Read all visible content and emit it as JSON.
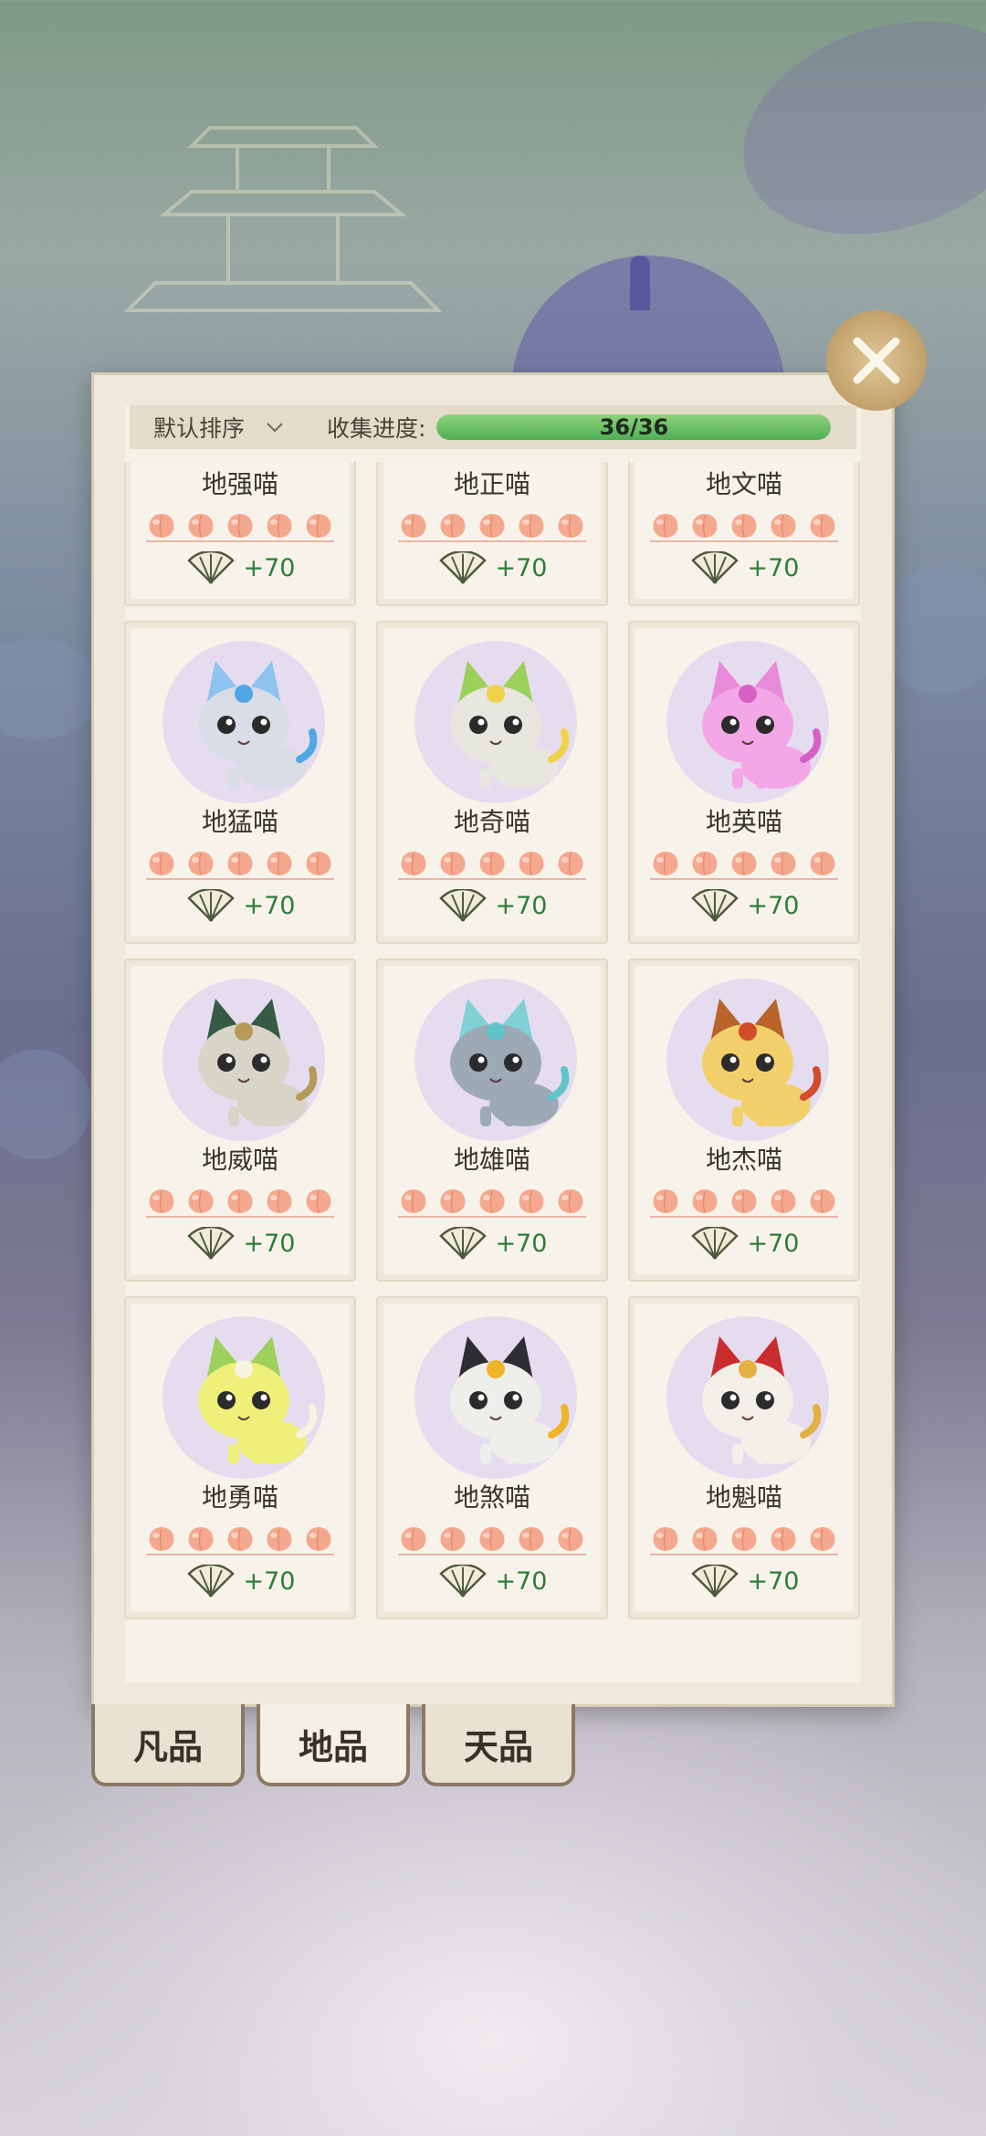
{
  "header": {
    "sort_label": "默认排序",
    "progress_label": "收集进度:",
    "progress_text": "36/36",
    "progress_fraction": 1.0
  },
  "cards": [
    {
      "name": "地强喵",
      "bonus": "+70",
      "peaches": 5,
      "portrait": "partial"
    },
    {
      "name": "地正喵",
      "bonus": "+70",
      "peaches": 5,
      "portrait": "partial"
    },
    {
      "name": "地文喵",
      "bonus": "+70",
      "peaches": 5,
      "portrait": "partial"
    },
    {
      "name": "地猛喵",
      "bonus": "+70",
      "peaches": 5,
      "portrait": "gray-blue-cat",
      "body": "#d9dde6",
      "ear": "#8ec3f0",
      "accent": "#4fa7e6"
    },
    {
      "name": "地奇喵",
      "bonus": "+70",
      "peaches": 5,
      "portrait": "leaf-cat",
      "body": "#e7e6df",
      "ear": "#9bd05a",
      "accent": "#f0d24a"
    },
    {
      "name": "地英喵",
      "bonus": "+70",
      "peaches": 5,
      "portrait": "pink-cat",
      "body": "#f3a7e6",
      "ear": "#e98ad9",
      "accent": "#d561c4"
    },
    {
      "name": "地威喵",
      "bonus": "+70",
      "peaches": 5,
      "portrait": "green-hood-cat",
      "body": "#d7d5c8",
      "ear": "#355a45",
      "accent": "#b69a58"
    },
    {
      "name": "地雄喵",
      "bonus": "+70",
      "peaches": 5,
      "portrait": "teal-cat",
      "body": "#9ea9b6",
      "ear": "#7fd1d6",
      "accent": "#5ec5c9"
    },
    {
      "name": "地杰喵",
      "bonus": "+70",
      "peaches": 5,
      "portrait": "gold-dragon-cat",
      "body": "#f2cf6a",
      "ear": "#b9642a",
      "accent": "#d24c2a"
    },
    {
      "name": "地勇喵",
      "bonus": "+70",
      "peaches": 5,
      "portrait": "lime-cat",
      "body": "#eef07a",
      "ear": "#9ed05d",
      "accent": "#f6f3e1"
    },
    {
      "name": "地煞喵",
      "bonus": "+70",
      "peaches": 5,
      "portrait": "black-gold-cat",
      "body": "#eeeeea",
      "ear": "#2d2d33",
      "accent": "#f0b429"
    },
    {
      "name": "地魁喵",
      "bonus": "+70",
      "peaches": 5,
      "portrait": "red-crown-cat",
      "body": "#f3efe9",
      "ear": "#c92d2d",
      "accent": "#e3b043"
    }
  ],
  "tabs": [
    {
      "label": "凡品",
      "active": false
    },
    {
      "label": "地品",
      "active": true
    },
    {
      "label": "天品",
      "active": false
    }
  ],
  "colors": {
    "bonus_text": "#2e7d3a",
    "progress_fill": "#4fae55",
    "peach": "#f2a287"
  },
  "icons": {
    "close": "close-icon",
    "sort": "chevron-down-icon",
    "peach": "peach-icon",
    "fan": "fan-icon"
  }
}
